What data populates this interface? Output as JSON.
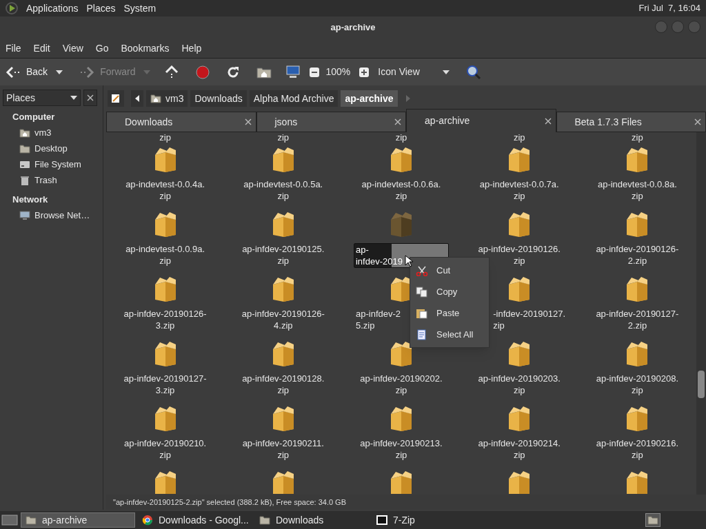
{
  "top_panel": {
    "menus": [
      "Applications",
      "Places",
      "System"
    ],
    "clock": "Fri Jul  7, 16:04"
  },
  "window": {
    "title": "ap-archive"
  },
  "menu_bar": [
    "File",
    "Edit",
    "View",
    "Go",
    "Bookmarks",
    "Help"
  ],
  "toolbar": {
    "back": {
      "label": "Back",
      "disabled": false
    },
    "forward": {
      "label": "Forward",
      "disabled": true
    },
    "zoom": "100%",
    "view": "Icon View"
  },
  "sidebar": {
    "title": "Places",
    "sections": [
      {
        "heading": "Computer",
        "items": [
          {
            "label": "vm3",
            "kind": "home"
          },
          {
            "label": "Desktop",
            "kind": "folder"
          },
          {
            "label": "File System",
            "kind": "drive"
          },
          {
            "label": "Trash",
            "kind": "trash"
          }
        ]
      },
      {
        "heading": "Network",
        "items": [
          {
            "label": "Browse Net…",
            "kind": "network"
          }
        ]
      }
    ]
  },
  "path_bar": [
    {
      "label": "vm3",
      "selected": false
    },
    {
      "label": "Downloads",
      "selected": false
    },
    {
      "label": "Alpha Mod Archive",
      "selected": false
    },
    {
      "label": "ap-archive",
      "selected": true
    }
  ],
  "tabs": [
    {
      "label": "Downloads",
      "selected": false
    },
    {
      "label": "jsons",
      "selected": false
    },
    {
      "label": "ap-archive",
      "selected": true
    },
    {
      "label": "Beta 1.7.3 Files",
      "selected": false
    }
  ],
  "partial_labels": [
    "zip",
    "zip",
    "zip",
    "zip",
    "zip"
  ],
  "files": [
    {
      "label": "ap-indevtest-0.0.4a.\nzip",
      "kind": "normal"
    },
    {
      "label": "ap-indevtest-0.0.5a.\nzip",
      "kind": "normal"
    },
    {
      "label": "ap-indevtest-0.0.6a.\nzip",
      "kind": "normal"
    },
    {
      "label": "ap-indevtest-0.0.7a.\nzip",
      "kind": "normal"
    },
    {
      "label": "ap-indevtest-0.0.8a.\nzip",
      "kind": "normal"
    },
    {
      "label": "ap-indevtest-0.0.9a.\nzip",
      "kind": "normal"
    },
    {
      "label": "ap-infdev-20190125.\nzip",
      "kind": "normal"
    },
    {
      "label": "ap-\ninfdev-2019",
      "kind": "renaming"
    },
    {
      "label": "ap-infdev-20190126.\nzip",
      "kind": "normal"
    },
    {
      "label": "ap-infdev-20190126-\n2.zip",
      "kind": "normal"
    },
    {
      "label": "ap-infdev-20190126-\n3.zip",
      "kind": "normal"
    },
    {
      "label": "ap-infdev-20190126-\n4.zip",
      "kind": "normal"
    },
    {
      "label": "ap-infdev-2\n5.zip",
      "kind": "covered_right"
    },
    {
      "label": "-infdev-20190127.\nzip",
      "kind": "covered_left"
    },
    {
      "label": "ap-infdev-20190127-\n2.zip",
      "kind": "normal"
    },
    {
      "label": "ap-infdev-20190127-\n3.zip",
      "kind": "normal"
    },
    {
      "label": "ap-infdev-20190128.\nzip",
      "kind": "normal"
    },
    {
      "label": "ap-infdev-20190202.\nzip",
      "kind": "normal"
    },
    {
      "label": "ap-infdev-20190203.\nzip",
      "kind": "normal"
    },
    {
      "label": "ap-infdev-20190208.\nzip",
      "kind": "normal"
    },
    {
      "label": "ap-infdev-20190210.\nzip",
      "kind": "normal"
    },
    {
      "label": "ap-infdev-20190211.\nzip",
      "kind": "normal"
    },
    {
      "label": "ap-infdev-20190213.\nzip",
      "kind": "normal"
    },
    {
      "label": "ap-infdev-20190214.\nzip",
      "kind": "normal"
    },
    {
      "label": "ap-infdev-20190216.\nzip",
      "kind": "normal"
    }
  ],
  "context_menu": [
    {
      "label": "Cut",
      "kind": "cut"
    },
    {
      "label": "Copy",
      "kind": "copy"
    },
    {
      "label": "Paste",
      "kind": "paste"
    },
    {
      "label": "Select All",
      "kind": "select_all"
    }
  ],
  "status_bar": "\"ap-infdev-20190125-2.zip\" selected (388.2 kB), Free space: 34.0 GB",
  "taskbar": [
    {
      "label": "ap-archive",
      "kind": "folder",
      "selected": true
    },
    {
      "label": "Downloads - Googl...",
      "kind": "browser",
      "selected": false
    },
    {
      "label": "Downloads",
      "kind": "folder",
      "selected": false
    },
    {
      "label": "7-Zip",
      "kind": "zip",
      "selected": false
    }
  ]
}
